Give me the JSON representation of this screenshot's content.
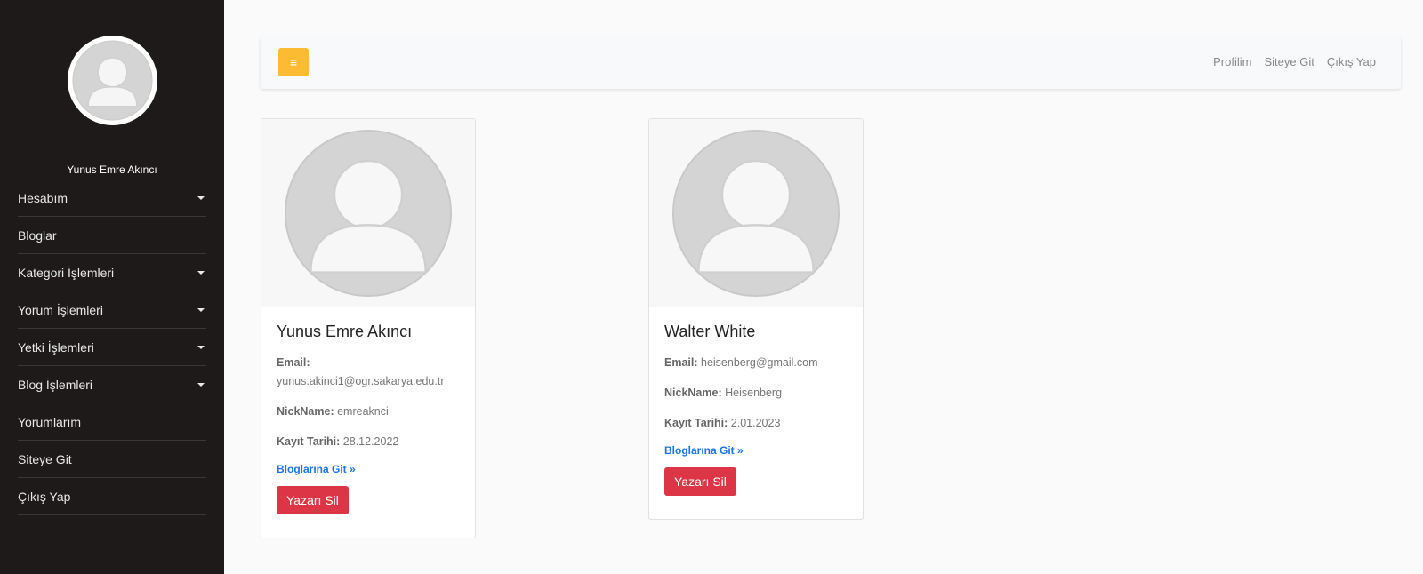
{
  "sidebar": {
    "user_name": "Yunus Emre Akıncı",
    "items": [
      {
        "label": "Hesabım",
        "dropdown": true
      },
      {
        "label": "Bloglar",
        "dropdown": false
      },
      {
        "label": "Kategori İşlemleri",
        "dropdown": true
      },
      {
        "label": "Yorum İşlemleri",
        "dropdown": true
      },
      {
        "label": "Yetki İşlemleri",
        "dropdown": true
      },
      {
        "label": "Blog İşlemleri",
        "dropdown": true
      },
      {
        "label": "Yorumlarım",
        "dropdown": false
      },
      {
        "label": "Siteye Git",
        "dropdown": false
      },
      {
        "label": "Çıkış Yap",
        "dropdown": false
      }
    ]
  },
  "topbar": {
    "toggle_icon": "≡",
    "links": [
      "Profilim",
      "Siteye Git",
      "Çıkış Yap"
    ]
  },
  "labels": {
    "email": "Email:",
    "nickname": "NickName:",
    "reg_date": "Kayıt Tarihi:",
    "blog_link": "Bloglarına Git »",
    "delete_btn": "Yazarı Sil"
  },
  "authors": [
    {
      "name": "Yunus Emre Akıncı",
      "email": "yunus.akinci1@ogr.sakarya.edu.tr",
      "nickname": "emreaknci",
      "reg_date": "28.12.2022"
    },
    {
      "name": "Walter White",
      "email": "heisenberg@gmail.com",
      "nickname": "Heisenberg",
      "reg_date": "2.01.2023"
    }
  ],
  "colors": {
    "sidebar_bg": "#1d1a19",
    "toggle_btn": "#fbbc33",
    "delete_btn": "#dc3545",
    "link": "#1a73e8"
  }
}
